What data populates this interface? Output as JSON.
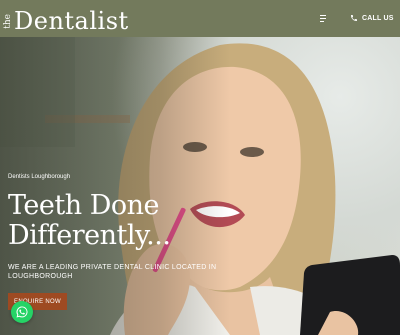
{
  "header": {
    "logo_prefix": "the",
    "logo_name": "Dentalist",
    "menu_icon": "menu-icon",
    "call_label": "CALL US",
    "call_icon": "phone-icon"
  },
  "hero": {
    "subtitle": "Dentists Loughborough",
    "headline": "Teeth Done Differently...",
    "tagline": "WE ARE A LEADING PRIVATE DENTAL CLINIC LOCATED IN LOUGHBOROUGH",
    "cta_label": "ENQUIRE NOW"
  },
  "floating": {
    "whatsapp_icon": "whatsapp-icon"
  },
  "colors": {
    "header_bg": "#737a5c",
    "cta_bg": "#9e4a22",
    "whatsapp_bg": "#25d366"
  }
}
